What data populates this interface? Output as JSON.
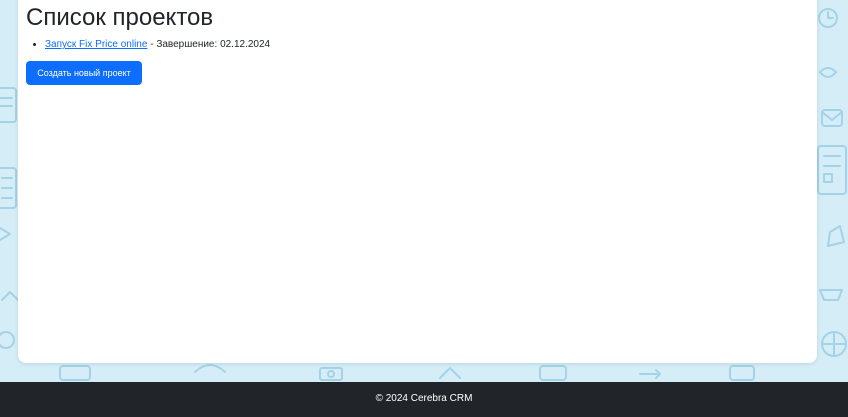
{
  "page": {
    "title": "Список проектов"
  },
  "projects": [
    {
      "name": "Запуск Fix Price online",
      "separator": " - ",
      "end_label": "Завершение: ",
      "end_date": "02.12.2024"
    }
  ],
  "actions": {
    "create_project_label": "Создать новый проект"
  },
  "footer": {
    "text": "© 2024 Cerebra CRM"
  },
  "colors": {
    "background": "#d4edf7",
    "pattern": "#9fd0e6",
    "accent": "#0d6efd",
    "footer_bg": "#212529"
  }
}
